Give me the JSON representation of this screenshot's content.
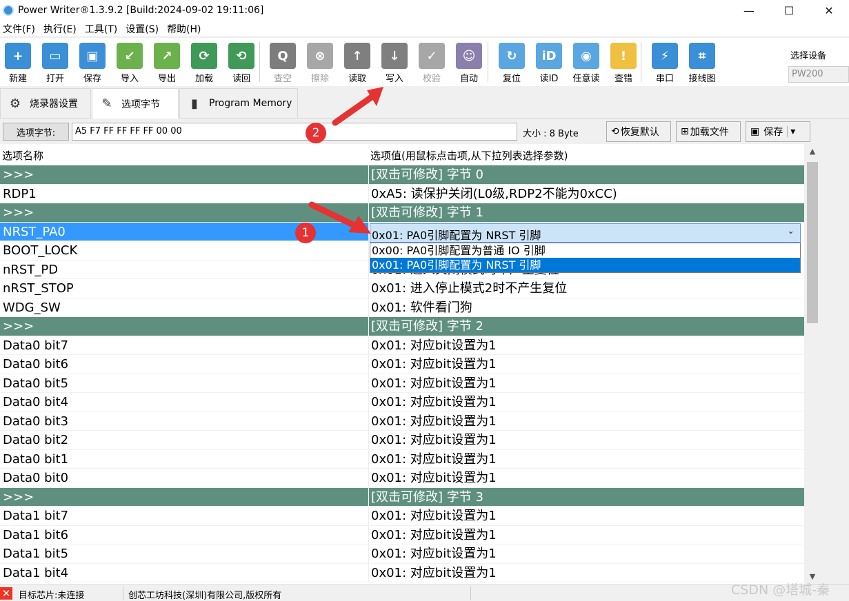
{
  "window": {
    "title": "Power Writer®1.3.9.2 [Build:2024-09-02 19:11:06]",
    "minimize": "—",
    "maximize": "☐",
    "close": "✕"
  },
  "menu": [
    "文件(F)",
    "执行(E)",
    "工具(T)",
    "设置(S)",
    "帮助(H)"
  ],
  "toolbar": {
    "buttons": [
      {
        "label": "新建",
        "icon": "new-icon",
        "color": "#3a8fd6",
        "glyph": "+",
        "disabled": false
      },
      {
        "label": "打开",
        "icon": "open-icon",
        "color": "#3a8fd6",
        "glyph": "▭",
        "disabled": false
      },
      {
        "label": "保存",
        "icon": "save-icon",
        "color": "#3a8fd6",
        "glyph": "▣",
        "disabled": false
      },
      {
        "label": "导入",
        "icon": "import-icon",
        "color": "#6cb24c",
        "glyph": "↙",
        "disabled": false
      },
      {
        "label": "导出",
        "icon": "export-icon",
        "color": "#6cb24c",
        "glyph": "↗",
        "disabled": false
      },
      {
        "label": "加载",
        "icon": "load-icon",
        "color": "#3f9a57",
        "glyph": "⟳",
        "disabled": false
      },
      {
        "label": "读回",
        "icon": "readback-icon",
        "color": "#3f9a57",
        "glyph": "⟲",
        "disabled": false
      },
      {
        "label": "查空",
        "icon": "blank-check-icon",
        "color": "#7d7d7d",
        "glyph": "Q",
        "disabled": true
      },
      {
        "label": "擦除",
        "icon": "erase-icon",
        "color": "#a7a7a7",
        "glyph": "⊗",
        "disabled": true
      },
      {
        "label": "读取",
        "icon": "read-icon",
        "color": "#7f7f7f",
        "glyph": "↑",
        "disabled": false
      },
      {
        "label": "写入",
        "icon": "write-icon",
        "color": "#7f7f7f",
        "glyph": "↓",
        "disabled": false
      },
      {
        "label": "校验",
        "icon": "verify-icon",
        "color": "#a7a7a7",
        "glyph": "✓",
        "disabled": true
      },
      {
        "label": "自动",
        "icon": "auto-icon",
        "color": "#8b7fae",
        "glyph": "☺",
        "disabled": false
      },
      {
        "label": "复位",
        "icon": "reset-icon",
        "color": "#5aa6e0",
        "glyph": "↻",
        "disabled": false
      },
      {
        "label": "读ID",
        "icon": "read-id-icon",
        "color": "#5aa6e0",
        "glyph": "iD",
        "disabled": false
      },
      {
        "label": "任意读",
        "icon": "any-read-icon",
        "color": "#5aa6e0",
        "glyph": "◉",
        "disabled": false
      },
      {
        "label": "查错",
        "icon": "error-check-icon",
        "color": "#f0c040",
        "glyph": "!",
        "disabled": false
      },
      {
        "label": "串口",
        "icon": "serial-port-icon",
        "color": "#3a8fd6",
        "glyph": "⚡",
        "disabled": false
      },
      {
        "label": "接线图",
        "icon": "wiring-diagram-icon",
        "color": "#3a8fd6",
        "glyph": "⌗",
        "disabled": false
      }
    ],
    "device_label": "选择设备",
    "device_value": "PW200"
  },
  "tabs": [
    {
      "label": "烧录器设置",
      "icon": "gear-icon"
    },
    {
      "label": "选项字节",
      "icon": "option-bytes-icon"
    },
    {
      "label": "Program Memory",
      "icon": "chip-icon"
    }
  ],
  "option_bar": {
    "label": "选项字节:",
    "value": "A5 F7 FF FF FF FF 00 00",
    "size": "大小 : 8 Byte",
    "restore": "恢复默认",
    "load_file": "加载文件",
    "save": "保存"
  },
  "grid": {
    "headers": [
      "选项名称",
      "选项值(用鼠标点击项,从下拉列表选择参数)"
    ],
    "rows": [
      {
        "name": ">>>",
        "value": "[双击可修改] 字节 0",
        "type": "group"
      },
      {
        "name": "RDP1",
        "value": "0xA5: 读保护关闭(L0级,RDP2不能为0xCC)",
        "type": "item"
      },
      {
        "name": ">>>",
        "value": "[双击可修改] 字节 1",
        "type": "group"
      },
      {
        "name": "NRST_PA0",
        "value": "",
        "type": "selected"
      },
      {
        "name": "BOOT_LOCK",
        "value": "",
        "type": "item"
      },
      {
        "name": "nRST_PD",
        "value": "0x01: 进入关闭模式时不产生复位",
        "type": "item"
      },
      {
        "name": "nRST_STOP",
        "value": "0x01: 进入停止模式2时不产生复位",
        "type": "item"
      },
      {
        "name": "WDG_SW",
        "value": "0x01: 软件看门狗",
        "type": "item"
      },
      {
        "name": ">>>",
        "value": "[双击可修改] 字节 2",
        "type": "group"
      },
      {
        "name": "Data0 bit7",
        "value": "0x01: 对应bit设置为1",
        "type": "item"
      },
      {
        "name": "Data0 bit6",
        "value": "0x01: 对应bit设置为1",
        "type": "item"
      },
      {
        "name": "Data0 bit5",
        "value": "0x01: 对应bit设置为1",
        "type": "item"
      },
      {
        "name": "Data0 bit4",
        "value": "0x01: 对应bit设置为1",
        "type": "item"
      },
      {
        "name": "Data0 bit3",
        "value": "0x01: 对应bit设置为1",
        "type": "item"
      },
      {
        "name": "Data0 bit2",
        "value": "0x01: 对应bit设置为1",
        "type": "item"
      },
      {
        "name": "Data0 bit1",
        "value": "0x01: 对应bit设置为1",
        "type": "item"
      },
      {
        "name": "Data0 bit0",
        "value": "0x01: 对应bit设置为1",
        "type": "item"
      },
      {
        "name": ">>>",
        "value": "[双击可修改] 字节 3",
        "type": "group"
      },
      {
        "name": "Data1 bit7",
        "value": "0x01: 对应bit设置为1",
        "type": "item"
      },
      {
        "name": "Data1 bit6",
        "value": "0x01: 对应bit设置为1",
        "type": "item"
      },
      {
        "name": "Data1 bit5",
        "value": "0x01: 对应bit设置为1",
        "type": "item"
      },
      {
        "name": "Data1 bit4",
        "value": "0x01: 对应bit设置为1",
        "type": "item"
      }
    ],
    "combo_value": "0x01: PA0引脚配置为 NRST 引脚",
    "dropdown_options": [
      "0x00: PA0引脚配置为普通 IO 引脚",
      "0x01: PA0引脚配置为 NRST 引脚"
    ]
  },
  "status": {
    "chip": "目标芯片:未连接",
    "copyright": "创芯工坊科技(深圳)有限公司,版权所有"
  },
  "annotations": {
    "badge1": "1",
    "badge2": "2"
  },
  "watermark": "CSDN @塔城-秦"
}
